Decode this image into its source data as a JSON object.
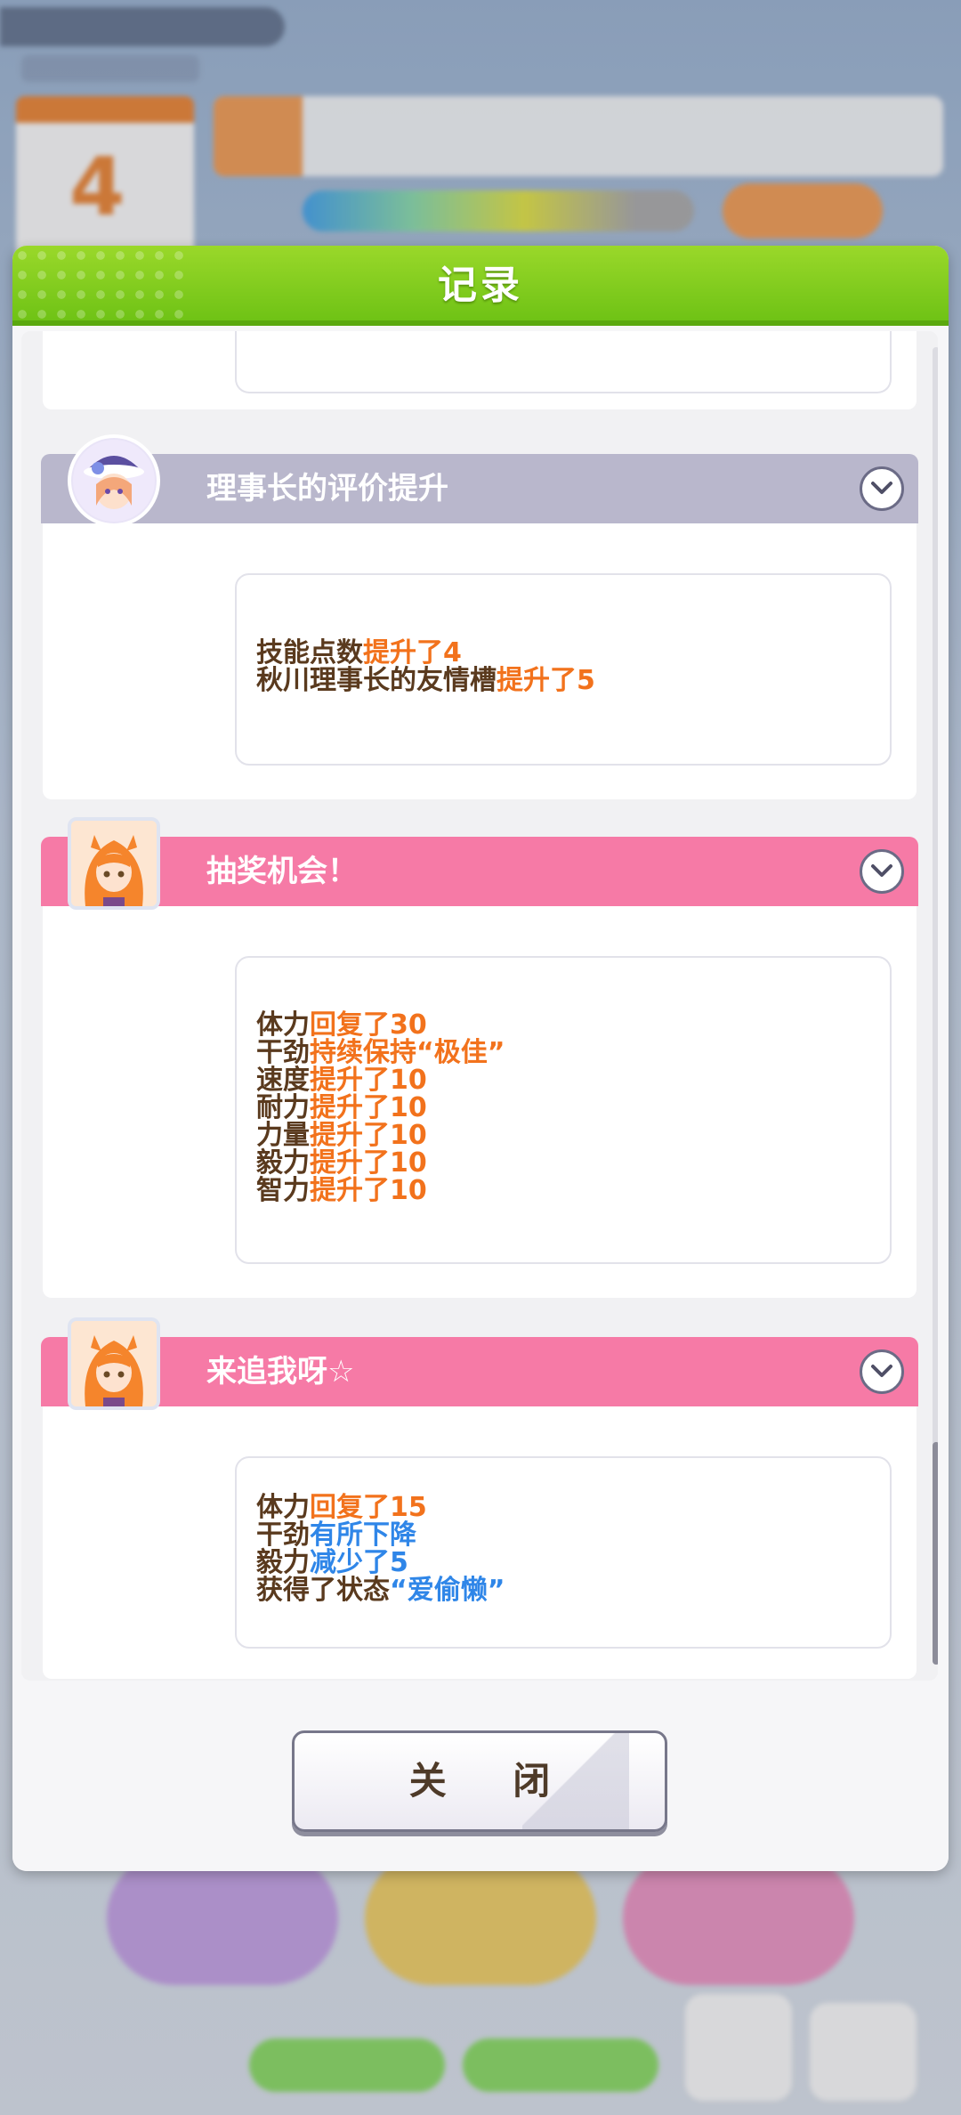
{
  "dialog": {
    "title": "记录",
    "close_label": "关 闭"
  },
  "records": [
    {
      "title": "理事长的评价提升",
      "header_color": "#b9b7cc",
      "avatar_icon": "chairman-avatar-icon",
      "lines": [
        [
          {
            "t": "技能点数",
            "c": "n"
          },
          {
            "t": "提升了4",
            "c": "up"
          }
        ],
        [
          {
            "t": "秋川理事长的友情槽",
            "c": "n"
          },
          {
            "t": "提升了5",
            "c": "up"
          }
        ]
      ]
    },
    {
      "title": "抽奖机会！",
      "header_color": "#f67aa6",
      "avatar_icon": "horse-girl-avatar-icon",
      "lines": [
        [
          {
            "t": "体力",
            "c": "n"
          },
          {
            "t": "回复了30",
            "c": "up"
          }
        ],
        [
          {
            "t": "干劲",
            "c": "n"
          },
          {
            "t": "持续保持“极佳”",
            "c": "up"
          }
        ],
        [
          {
            "t": "速度",
            "c": "n"
          },
          {
            "t": "提升了10",
            "c": "up"
          }
        ],
        [
          {
            "t": "耐力",
            "c": "n"
          },
          {
            "t": "提升了10",
            "c": "up"
          }
        ],
        [
          {
            "t": "力量",
            "c": "n"
          },
          {
            "t": "提升了10",
            "c": "up"
          }
        ],
        [
          {
            "t": "毅力",
            "c": "n"
          },
          {
            "t": "提升了10",
            "c": "up"
          }
        ],
        [
          {
            "t": "智力",
            "c": "n"
          },
          {
            "t": "提升了10",
            "c": "up"
          }
        ]
      ]
    },
    {
      "title": "来追我呀☆",
      "header_color": "#f67aa6",
      "avatar_icon": "horse-girl-avatar-icon",
      "lines": [
        [
          {
            "t": "体力",
            "c": "n"
          },
          {
            "t": "回复了15",
            "c": "up"
          }
        ],
        [
          {
            "t": "干劲",
            "c": "n"
          },
          {
            "t": "有所下降",
            "c": "down"
          }
        ],
        [
          {
            "t": "毅力",
            "c": "n"
          },
          {
            "t": "减少了5",
            "c": "down"
          }
        ],
        [
          {
            "t": "获得了状态",
            "c": "n"
          },
          {
            "t": "“爱偷懒”",
            "c": "down"
          }
        ]
      ]
    }
  ],
  "colors": {
    "increase": "#f2721c",
    "decrease": "#2f86e8",
    "normal": "#5a3a1e",
    "header_green": "#7ccc1c"
  }
}
